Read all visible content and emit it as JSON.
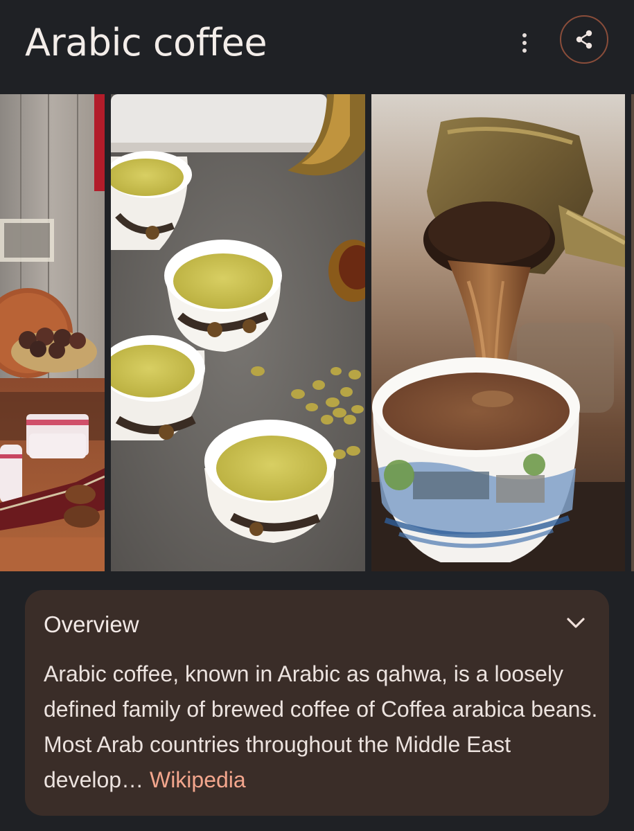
{
  "header": {
    "title": "Arabic coffee",
    "more_icon": "more-vert-icon",
    "share_icon": "share-icon"
  },
  "colors": {
    "background": "#1f2125",
    "card": "#3a2d28",
    "accent": "#f3a68d",
    "share_ring": "#8a4d3a"
  },
  "gallery": {
    "photos": [
      "arabic-coffee-cups-with-dates-photo",
      "yellow-qahwa-cups-with-cardamom-photo",
      "coffee-pouring-from-dallah-photo",
      "next-photo-partial"
    ]
  },
  "overview": {
    "heading": "Overview",
    "text": "Arabic coffee, known in Arabic as qahwa, is a loosely defined family of brewed coffee of Coffea arabica beans. Most Arab countries throughout the Middle East develop…",
    "source": "Wikipedia",
    "expand_icon": "chevron-down-icon"
  }
}
